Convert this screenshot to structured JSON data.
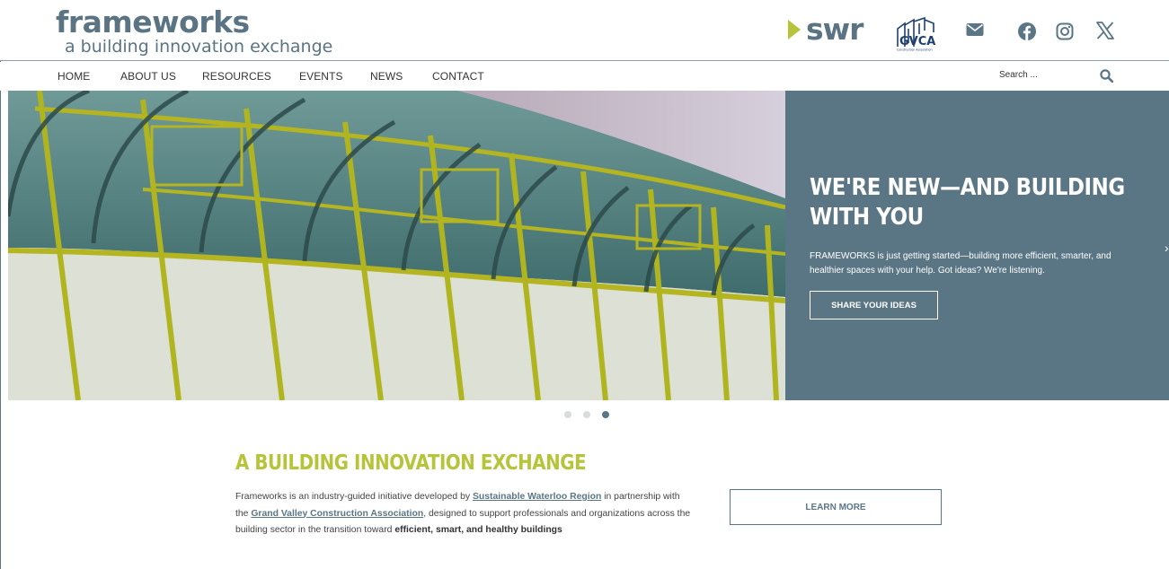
{
  "header": {
    "logo_title": "frameworks",
    "logo_subtitle": "a building innovation exchange",
    "partner_swr": "swr",
    "partner_gvca_name": "GVCA",
    "partner_gvca_caption": "Construction Association",
    "social": [
      "mail-icon",
      "facebook-icon",
      "instagram-icon",
      "x-icon"
    ]
  },
  "nav": {
    "items": [
      "HOME",
      "ABOUT US",
      "RESOURCES",
      "EVENTS",
      "NEWS",
      "CONTACT"
    ],
    "search_placeholder": "Search ..."
  },
  "hero": {
    "heading": "WE'RE NEW—AND BUILDING WITH YOU",
    "text": "FRAMEWORKS is just getting started—building more efficient, smarter, and healthier spaces with your help. Got ideas? We're listening.",
    "button": "SHARE YOUR IDEAS",
    "next_arrow": "›",
    "slides": 3,
    "active_slide": 3
  },
  "intro": {
    "title": "A BUILDING INNOVATION EXCHANGE",
    "text_1": "Frameworks is an industry-guided initiative developed by ",
    "link_1": "Sustainable Waterloo Region",
    "text_2": " in partnership with the ",
    "link_2": "Grand Valley Construction Association",
    "text_3": ", designed to support professionals and organizations across the building sector in the transition toward ",
    "bold": "efficient, smart, and healthy buildings",
    "button": "LEARN MORE"
  },
  "colors": {
    "slate": "#5a7685",
    "lime": "#b5c439"
  }
}
